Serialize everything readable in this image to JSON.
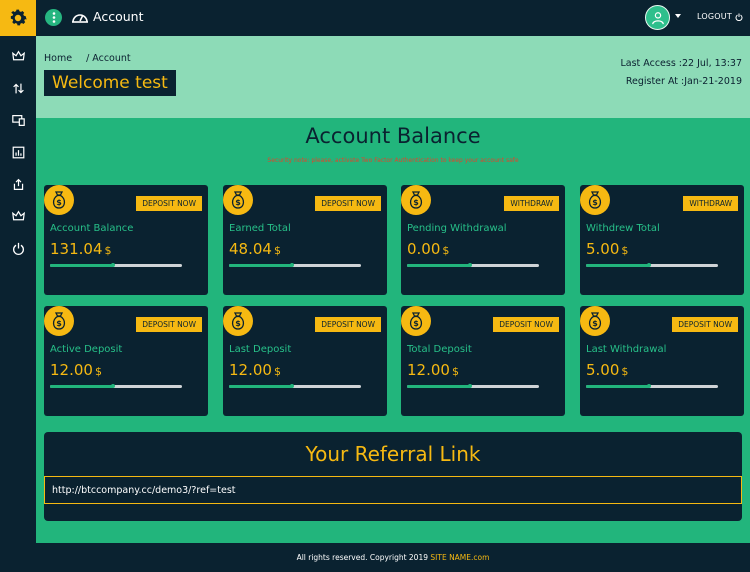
{
  "topbar": {
    "title": "Account",
    "logout_label": "LOGOUT"
  },
  "sidebar": {
    "items": [
      {
        "icon": "crown-icon"
      },
      {
        "icon": "transfer-icon"
      },
      {
        "icon": "devices-icon"
      },
      {
        "icon": "chart-icon"
      },
      {
        "icon": "share-icon"
      },
      {
        "icon": "crown-icon"
      },
      {
        "icon": "power-icon"
      }
    ]
  },
  "header": {
    "breadcrumb_home": "Home",
    "breadcrumb_current": "/ Account",
    "welcome": "Welcome test",
    "last_access": "Last Access :22 Jul, 13:37",
    "register_at": "Register At :Jan-21-2019"
  },
  "balance": {
    "title": "Account Balance",
    "notice": "Security note: please, activate Two Factor Authentication to keep your account safe",
    "currency": "$",
    "cards": [
      {
        "label": "Account Balance",
        "value": "131.04",
        "badge": "DEPOSIT NOW",
        "progress": 0.48
      },
      {
        "label": "Earned Total",
        "value": "48.04",
        "badge": "DEPOSIT NOW",
        "progress": 0.48
      },
      {
        "label": "Pending Withdrawal",
        "value": "0.00",
        "badge": "WITHDRAW",
        "progress": 0.48
      },
      {
        "label": "Withdrew Total",
        "value": "5.00",
        "badge": "WITHDRAW",
        "progress": 0.48
      },
      {
        "label": "Active Deposit",
        "value": "12.00",
        "badge": "DEPOSIT NOW",
        "progress": 0.48
      },
      {
        "label": "Last Deposit",
        "value": "12.00",
        "badge": "DEPOSIT NOW",
        "progress": 0.48
      },
      {
        "label": "Total Deposit",
        "value": "12.00",
        "badge": "DEPOSIT NOW",
        "progress": 0.48
      },
      {
        "label": "Last Withdrawal",
        "value": "5.00",
        "badge": "DEPOSIT NOW",
        "progress": 0.48
      }
    ]
  },
  "referral": {
    "title": "Your Referral Link",
    "link": "http://btccompany.cc/demo3/?ref=test"
  },
  "footer": {
    "text": "All rights reserved. Copyright 2019",
    "site_name": "SITE NAME.com"
  },
  "colors": {
    "navy": "#0a2230",
    "accent_yellow": "#f6b912",
    "green": "#22b57c",
    "header_green": "#8ddbb7"
  }
}
